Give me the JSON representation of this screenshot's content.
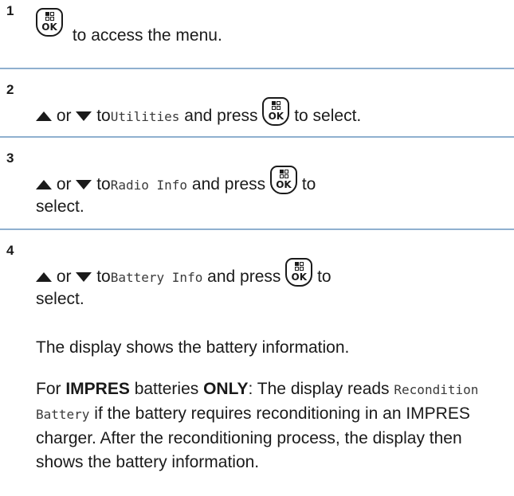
{
  "steps": [
    {
      "number": "1",
      "text": "to access the menu."
    },
    {
      "number": "2",
      "or": "or",
      "to": "to",
      "item": "Utilities",
      "press": "and press",
      "suffix": "to select."
    },
    {
      "number": "3",
      "or": "or",
      "to": "to",
      "item": "Radio Info",
      "press": "and press",
      "suffix": "to",
      "suffix2": "select."
    },
    {
      "number": "4",
      "or": "or",
      "to": "to",
      "item": "Battery Info",
      "press": "and press",
      "suffix": "to",
      "suffix2": "select."
    }
  ],
  "ok_key_label": "OK",
  "notes": {
    "display_shows": "The display shows the battery information.",
    "impres_prefix": "For",
    "impres_brand": "IMPRES",
    "impres_mid": "batteries",
    "impres_only": "ONLY",
    "impres_tail": ": The display reads",
    "recondition_label": "Recondition Battery",
    "recondition_tail": "if the battery requires reconditioning in an IMPRES charger. After the reconditioning process, the display then shows the battery information."
  },
  "colors": {
    "rule": "#8fb0cf",
    "text": "#1a1a1a"
  },
  "icons": {
    "key": "ok-menu-key-icon",
    "up": "up-arrow-icon",
    "down": "down-arrow-icon"
  }
}
